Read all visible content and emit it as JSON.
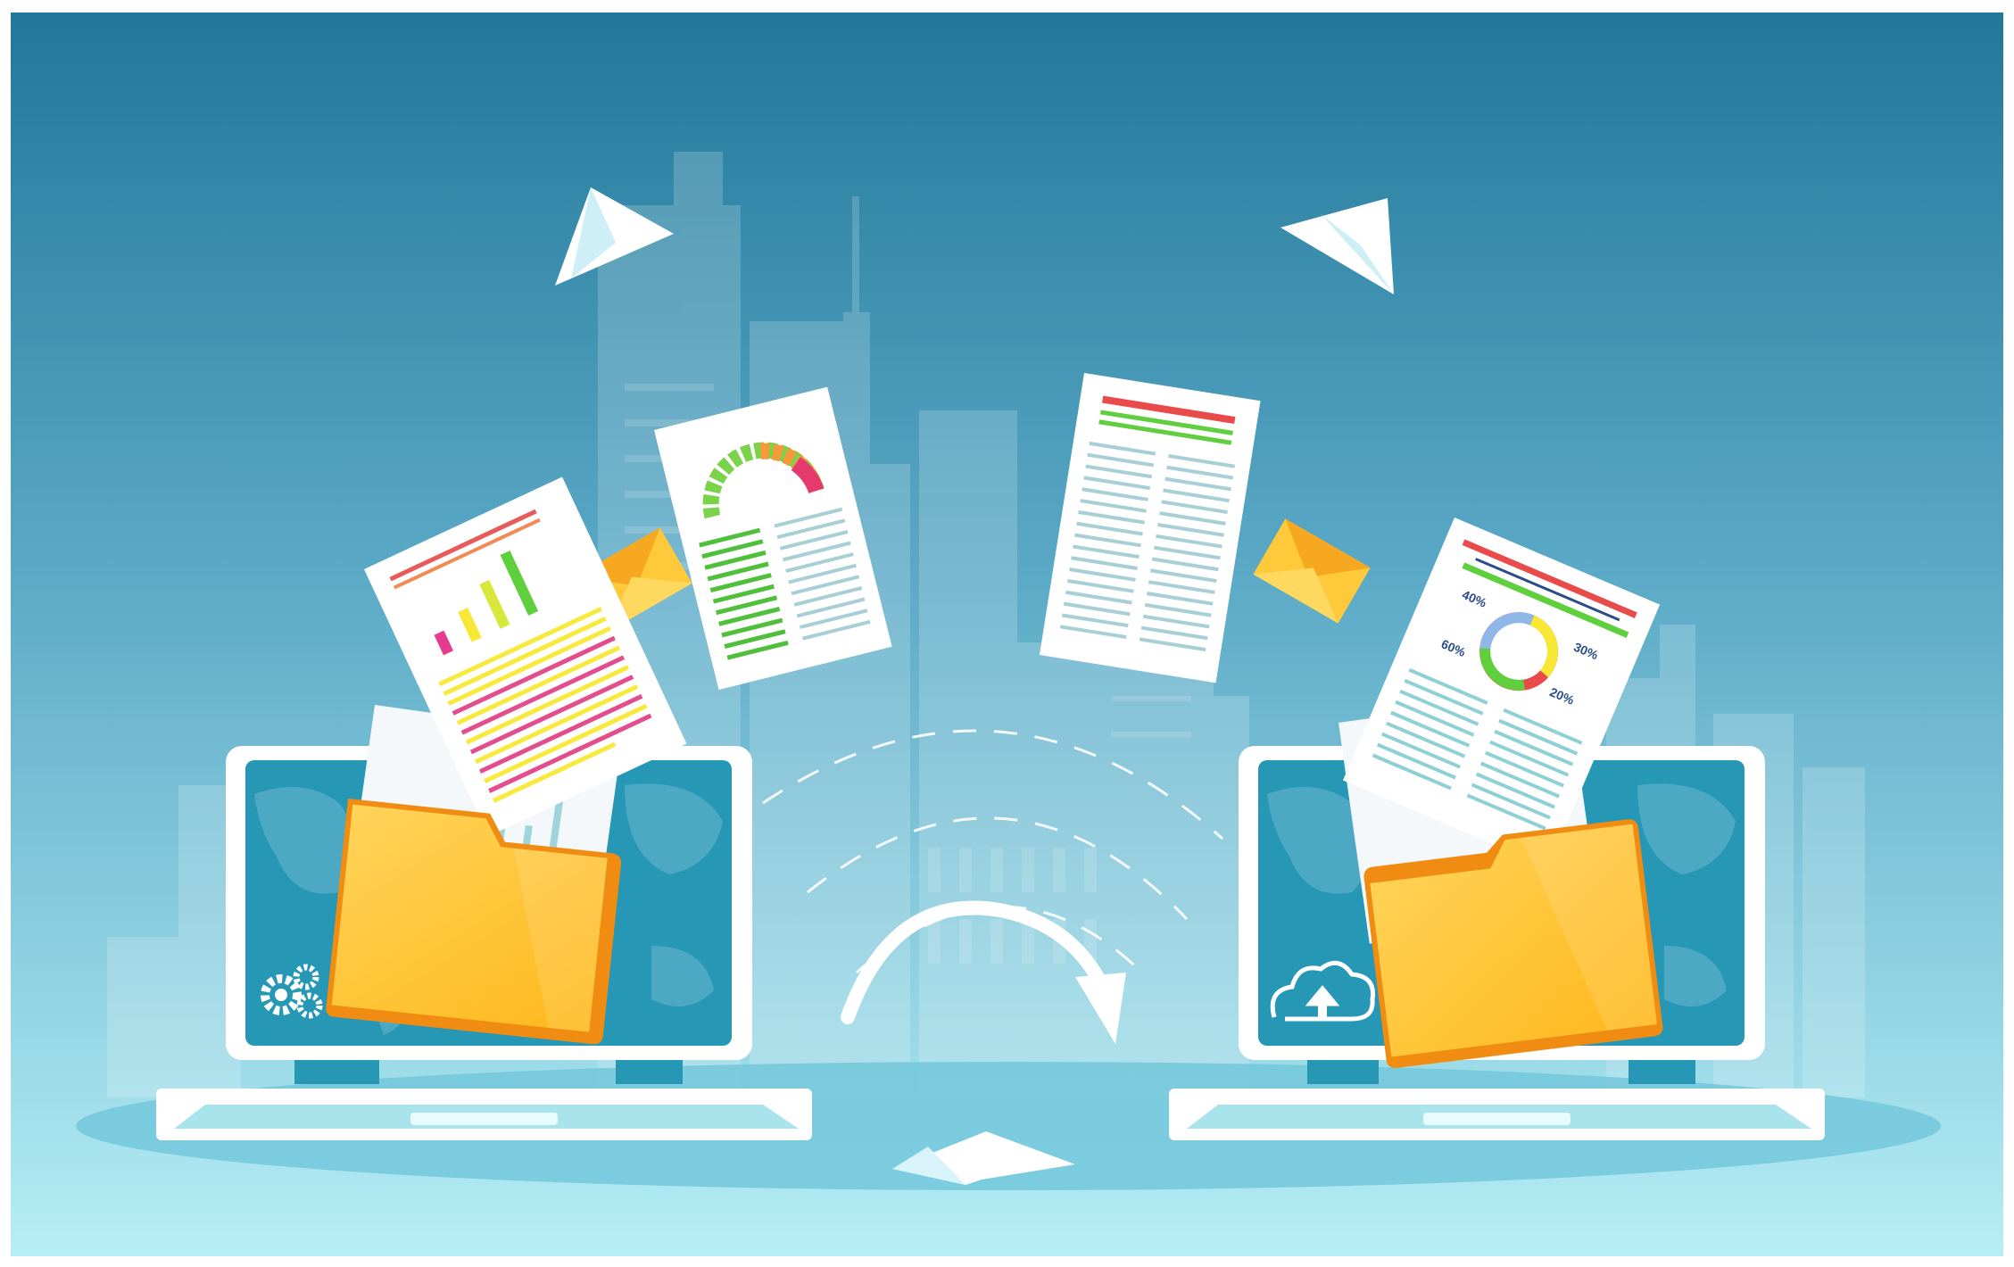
{
  "illustration": {
    "colors": {
      "sky_top": "#23799b",
      "sky_bottom": "#b3ecf4",
      "folder": "#ffc12e",
      "folder_edge": "#f08c12",
      "screen": "#2797b6",
      "laptop_body": "#ffffff",
      "envelope": "#ffc93c"
    },
    "left_screen_icon": "gears-icon",
    "right_screen_icon": "cloud-upload-icon",
    "donut_labels": [
      "40%",
      "30%",
      "60%",
      "20%"
    ]
  }
}
